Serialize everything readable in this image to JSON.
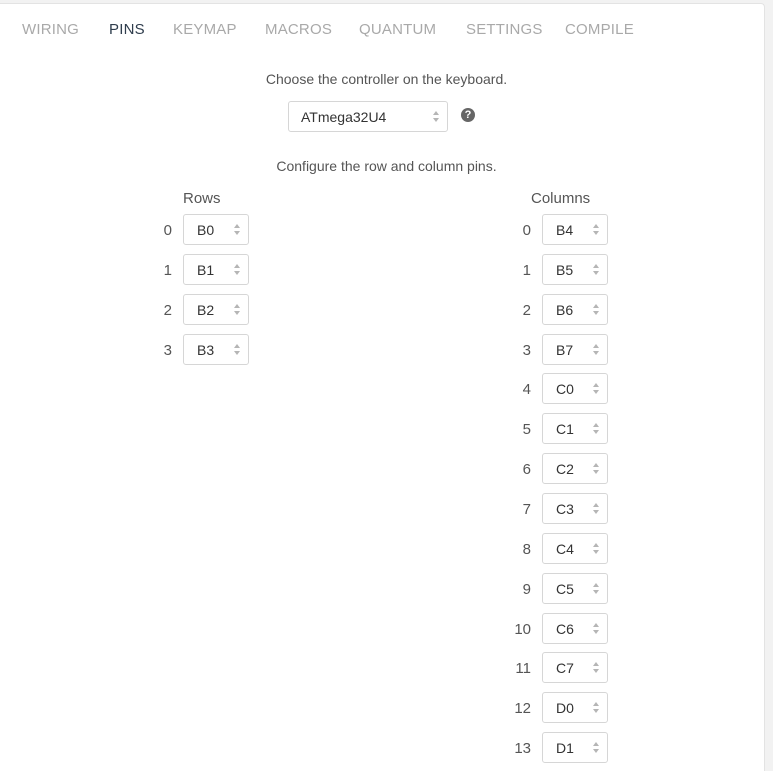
{
  "tabs": [
    {
      "label": "WIRING",
      "active": false
    },
    {
      "label": "PINS",
      "active": true
    },
    {
      "label": "KEYMAP",
      "active": false
    },
    {
      "label": "MACROS",
      "active": false
    },
    {
      "label": "QUANTUM",
      "active": false
    },
    {
      "label": "SETTINGS",
      "active": false
    },
    {
      "label": "COMPILE",
      "active": false
    }
  ],
  "controller": {
    "prompt": "Choose the controller on the keyboard.",
    "selected": "ATmega32U4",
    "help_icon": "question-circle-icon",
    "help_glyph": "?"
  },
  "pins": {
    "prompt": "Configure the row and column pins.",
    "rows_heading": "Rows",
    "columns_heading": "Columns",
    "rows": [
      {
        "index": "0",
        "pin": "B0"
      },
      {
        "index": "1",
        "pin": "B1"
      },
      {
        "index": "2",
        "pin": "B2"
      },
      {
        "index": "3",
        "pin": "B3"
      }
    ],
    "columns": [
      {
        "index": "0",
        "pin": "B4"
      },
      {
        "index": "1",
        "pin": "B5"
      },
      {
        "index": "2",
        "pin": "B6"
      },
      {
        "index": "3",
        "pin": "B7"
      },
      {
        "index": "4",
        "pin": "C0"
      },
      {
        "index": "5",
        "pin": "C1"
      },
      {
        "index": "6",
        "pin": "C2"
      },
      {
        "index": "7",
        "pin": "C3"
      },
      {
        "index": "8",
        "pin": "C4"
      },
      {
        "index": "9",
        "pin": "C5"
      },
      {
        "index": "10",
        "pin": "C6"
      },
      {
        "index": "11",
        "pin": "C7"
      },
      {
        "index": "12",
        "pin": "D0"
      },
      {
        "index": "13",
        "pin": "D1"
      }
    ]
  },
  "colors": {
    "active_tab": "#2f3d4d",
    "inactive_tab": "#a9a9a9",
    "border": "#d6d6d6"
  }
}
